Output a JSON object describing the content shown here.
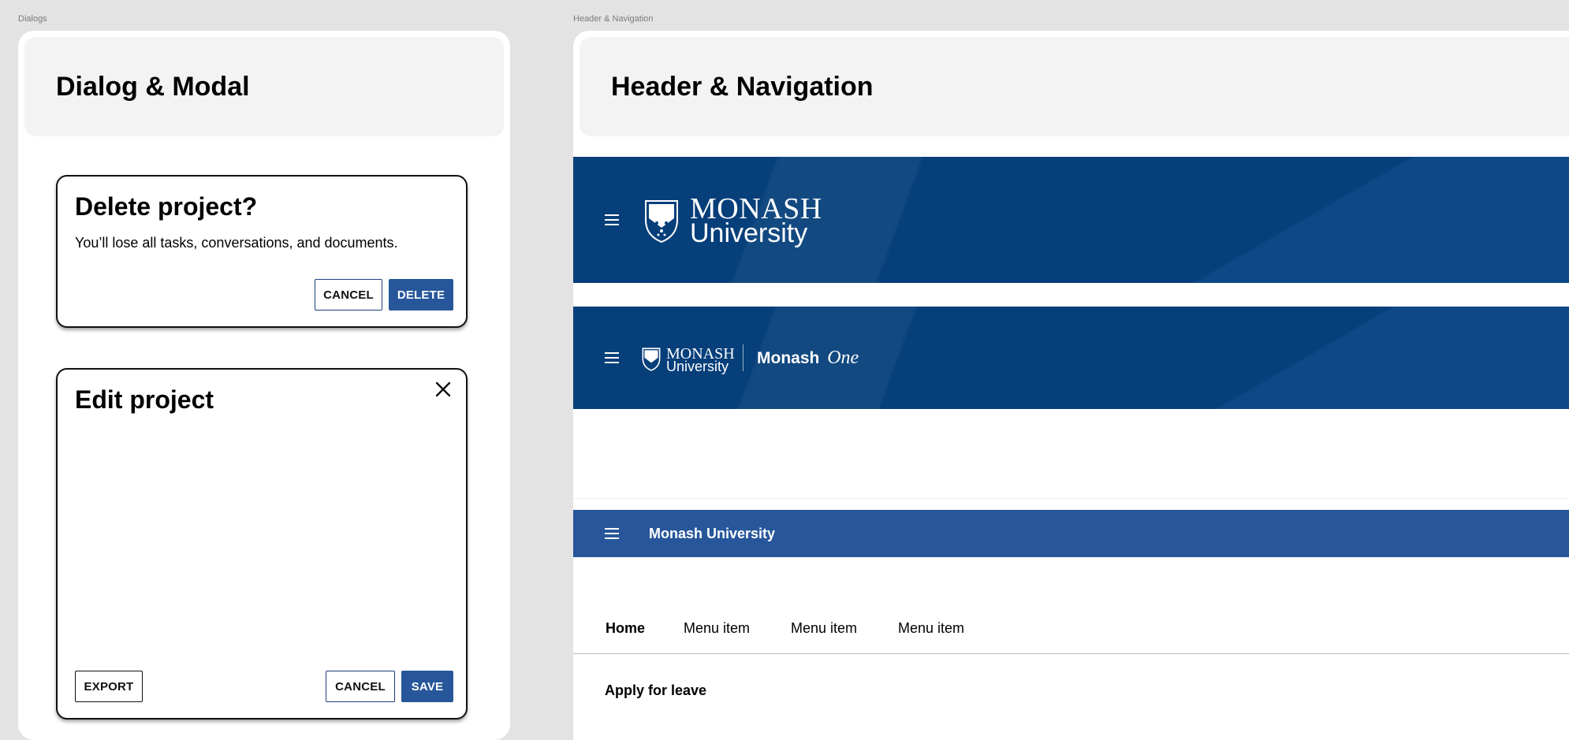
{
  "dialogs_frame": {
    "label": "Dialogs",
    "title": "Dialog & Modal",
    "delete_dialog": {
      "title": "Delete project?",
      "body": "You’ll lose all tasks, conversations, and documents.",
      "cancel_label": "CANCEL",
      "delete_label": "DELETE"
    },
    "edit_dialog": {
      "title": "Edit project",
      "export_label": "EXPORT",
      "cancel_label": "CANCEL",
      "save_label": "SAVE"
    }
  },
  "nav_frame": {
    "label": "Header & Navigation",
    "title": "Header & Navigation",
    "banner1": {
      "logo_line1": "MONASH",
      "logo_line2": "University"
    },
    "banner2": {
      "logo_line1": "MONASH",
      "logo_line2": "University",
      "product_name": "Monash",
      "product_script": "One"
    },
    "appbar": {
      "title": "Monash University"
    },
    "menu": {
      "items": [
        {
          "label": "Home"
        },
        {
          "label": "Menu item"
        },
        {
          "label": "Menu item"
        },
        {
          "label": "Menu item"
        }
      ]
    },
    "section_title": "Apply for leave"
  },
  "colors": {
    "banner_blue": "#063f7a",
    "appbar_blue": "#27579a",
    "primary_button": "#27579a"
  }
}
